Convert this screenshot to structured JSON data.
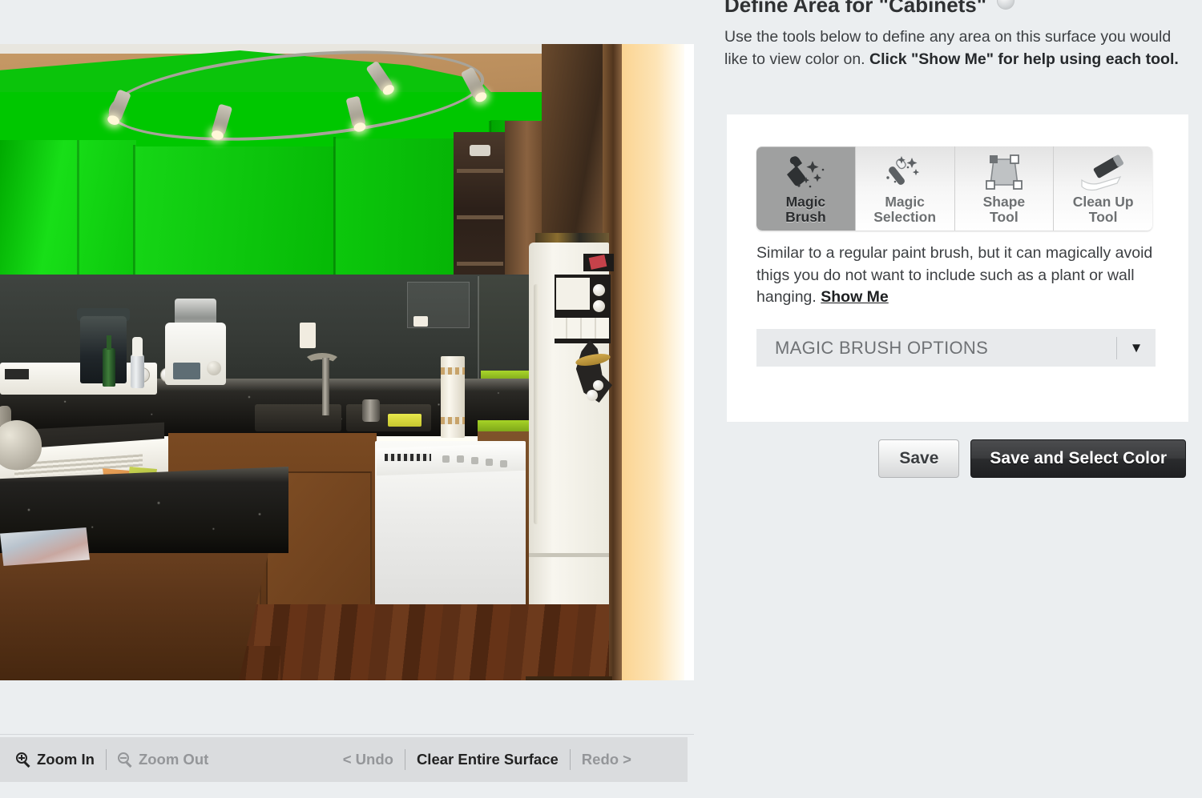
{
  "panel": {
    "title": "Define Area for \"Cabinets\"",
    "help_icon": "help-circle-icon",
    "intro_part1": "Use the tools below to define any area on this surface you would like to view color on. ",
    "intro_bold": "Click \"Show Me\" for help using each tool."
  },
  "tools": {
    "items": [
      {
        "label_line1": "Magic",
        "label_line2": "Brush",
        "icon": "magic-brush-icon",
        "active": true
      },
      {
        "label_line1": "Magic",
        "label_line2": "Selection",
        "icon": "magic-wand-icon",
        "active": false
      },
      {
        "label_line1": "Shape",
        "label_line2": "Tool",
        "icon": "shape-polygon-icon",
        "active": false
      },
      {
        "label_line1": "Clean Up",
        "label_line2": "Tool",
        "icon": "eraser-icon",
        "active": false
      }
    ],
    "description": "Similar to a regular paint brush, but it can magically avoid thigs you do not want to include such as a plant or wall hanging. ",
    "show_me_link": "Show Me"
  },
  "options": {
    "label": "MAGIC BRUSH OPTIONS",
    "caret": "▼"
  },
  "actions": {
    "save": "Save",
    "save_and_select_color": "Save and Select Color"
  },
  "toolbar": {
    "zoom_in": "Zoom In",
    "zoom_out": "Zoom Out",
    "undo": "< Undo",
    "clear_entire_surface": "Clear Entire Surface",
    "redo": "Redo >"
  },
  "canvas": {
    "mask_color": "#00c700",
    "description": "kitchen photo with upper cabinets masked in green"
  },
  "colors": {
    "page_background": "#ebeef0",
    "card_background": "#ffffff",
    "toolbar_background": "#dadcde",
    "active_tab": "#9fa0a0",
    "primary_button": "#2a2b2d",
    "mask_green": "#00c700"
  }
}
